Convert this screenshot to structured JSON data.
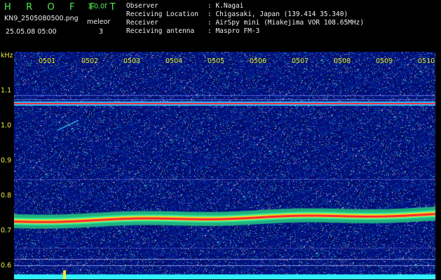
{
  "header": {
    "program": "H R O F F T",
    "version": "1.0.0f",
    "filename": "KN9_2505080500.png",
    "mode_label": "meleor",
    "mode_value": "3",
    "datetime": "25.05.08 05:00",
    "rows": [
      {
        "label": "Observer",
        "value": ": K.Nagai"
      },
      {
        "label": "Receiving Location",
        "value": ": Chigasaki, Japan (139.414 35.340)"
      },
      {
        "label": "Receiver",
        "value": ": AirSpy mini (Miakejima VOR 108.65MHz)"
      },
      {
        "label": "Receiving antenna",
        "value": ": Maspro FM-3"
      }
    ]
  },
  "plot": {
    "yunit": "kHz",
    "yticks": [
      "1.1",
      "1.0",
      "0.9",
      "0.8",
      "0.7",
      "0.6"
    ],
    "xticks": [
      "0501",
      "0502",
      "0503",
      "0504",
      "0505",
      "0506",
      "0507",
      "0508",
      "0509",
      "0510"
    ],
    "colors": {
      "noise_background": "#0a0a78",
      "carrier": "#ff2030",
      "trace": "#30f0ff",
      "axis_text": "#f0f000",
      "header_green": "#3cf23c"
    }
  }
}
